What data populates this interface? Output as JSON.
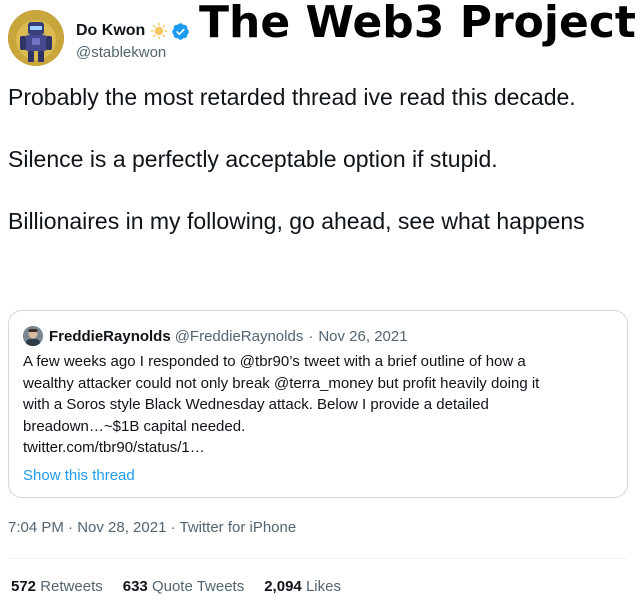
{
  "overlay": {
    "title": "The Web3 Project"
  },
  "author": {
    "display_name": "Do Kwon",
    "handle": "@stablekwon",
    "badges": [
      "sun-icon",
      "verified-icon"
    ],
    "verified_color": "#1d9bf0"
  },
  "tweet": {
    "paragraphs": [
      "Probably the most retarded thread ive read this decade.",
      "Silence is a perfectly acceptable option if stupid.",
      "Billionaires in my following, go ahead, see what happens"
    ]
  },
  "quote": {
    "name": "FreddieRaynolds",
    "handle": "@FreddieRaynolds",
    "separator": "·",
    "date": "Nov 26, 2021",
    "lines": [
      "A few weeks ago I responded to @tbr90’s tweet with a brief outline of how a",
      "wealthy attacker could not only break @terra_money but profit heavily doing it",
      "with a Soros style Black Wednesday attack. Below I provide a detailed",
      "breadown…~$1B capital needed.",
      "twitter.com/tbr90/status/1…"
    ],
    "show_thread": "Show this thread"
  },
  "meta": {
    "timestamp": "7:04 PM · Nov 28, 2021 · Twitter for iPhone"
  },
  "stats": {
    "retweets_count": "572",
    "retweets_label": "Retweets",
    "quotes_count": "633",
    "quotes_label": "Quote Tweets",
    "likes_count": "2,094",
    "likes_label": "Likes"
  },
  "colors": {
    "link": "#1d9bf0",
    "secondary_text": "#536471",
    "border": "#cfd9de"
  }
}
